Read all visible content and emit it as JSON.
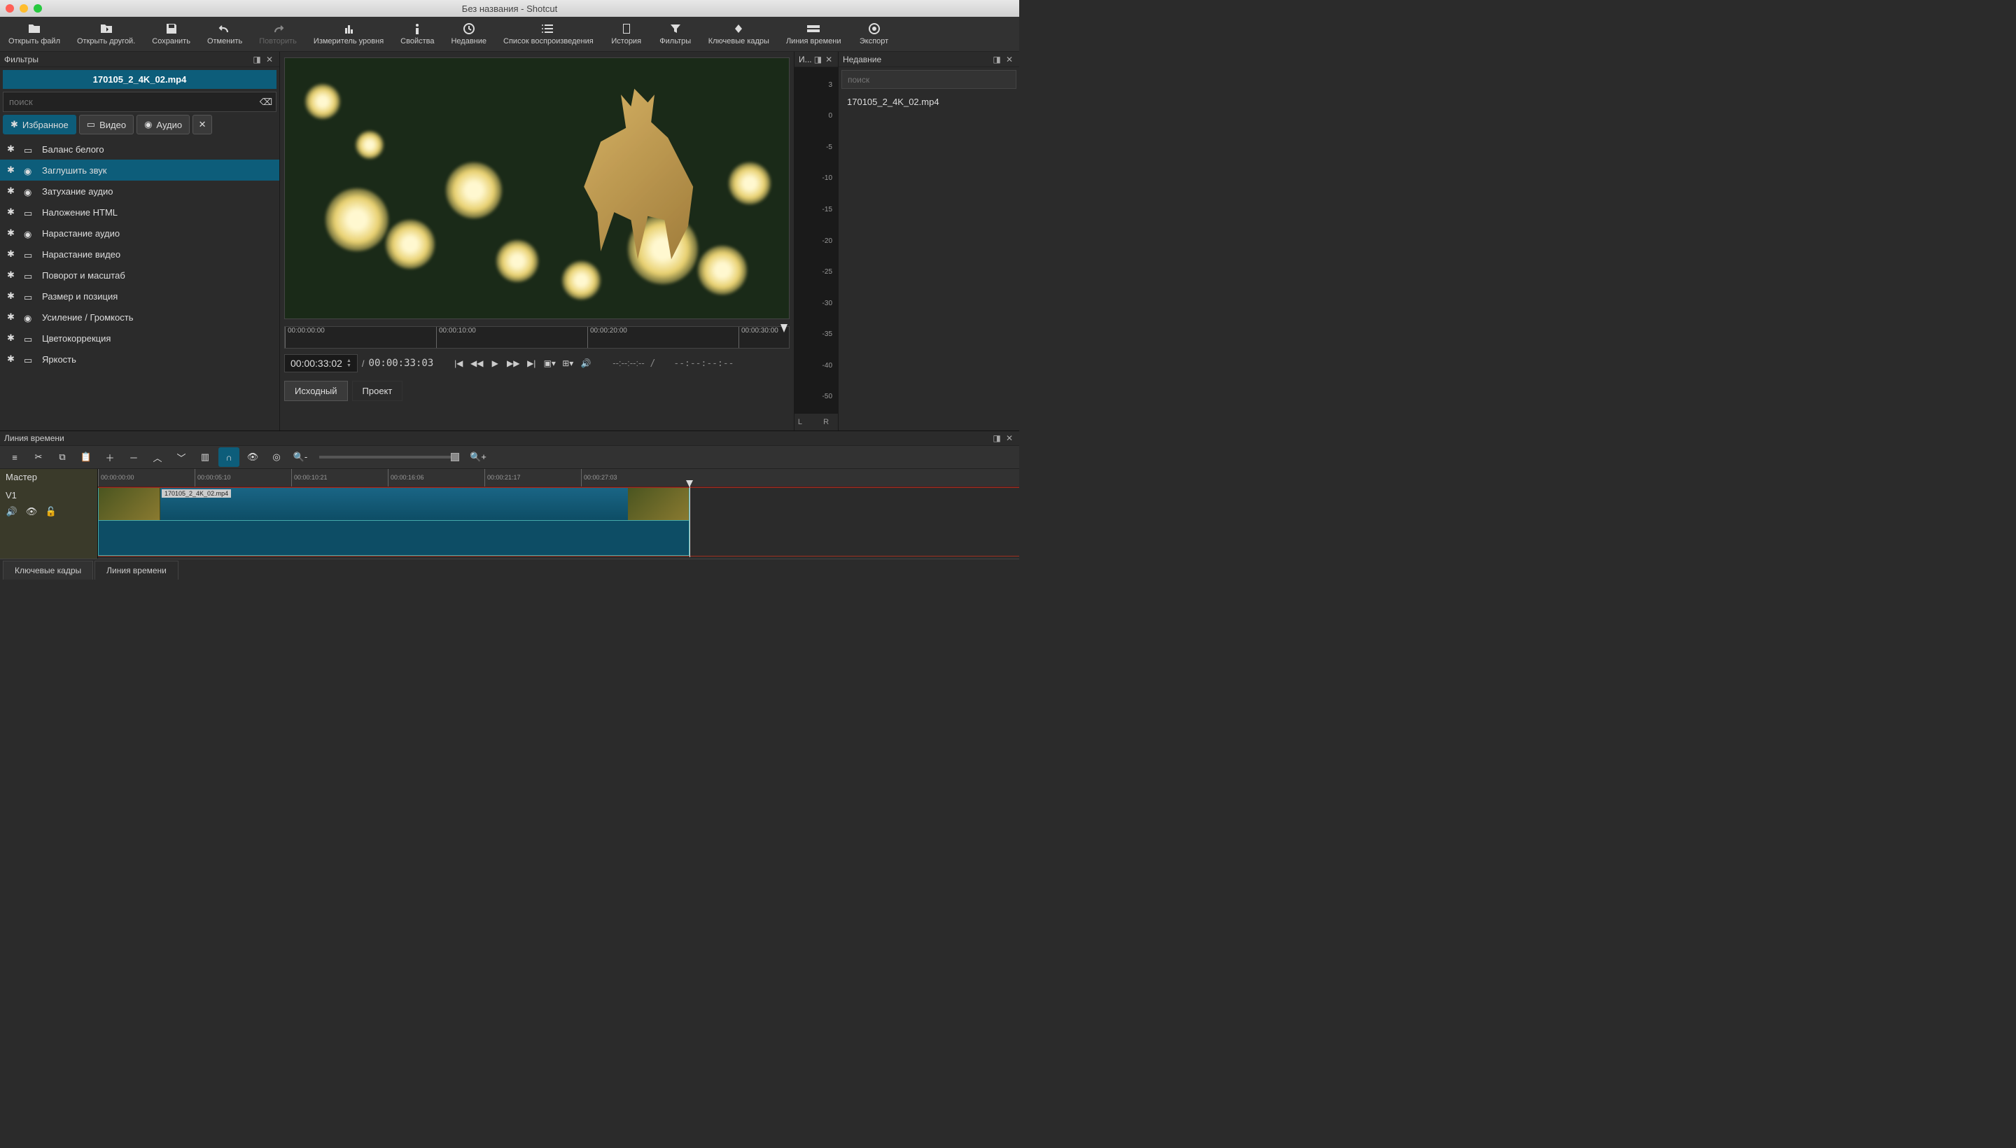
{
  "window": {
    "title": "Без названия - Shotcut"
  },
  "toolbar": [
    {
      "id": "open-file",
      "label": "Открыть файл",
      "icon": "folder"
    },
    {
      "id": "open-other",
      "label": "Открыть другой.",
      "icon": "folder-arrow"
    },
    {
      "id": "save",
      "label": "Сохранить",
      "icon": "save"
    },
    {
      "id": "undo",
      "label": "Отменить",
      "icon": "undo"
    },
    {
      "id": "redo",
      "label": "Повторить",
      "icon": "redo",
      "disabled": true
    },
    {
      "id": "peak-meter",
      "label": "Измеритель уровня",
      "icon": "meter"
    },
    {
      "id": "properties",
      "label": "Свойства",
      "icon": "info"
    },
    {
      "id": "recent",
      "label": "Недавние",
      "icon": "clock"
    },
    {
      "id": "playlist",
      "label": "Список воспроизведения",
      "icon": "list"
    },
    {
      "id": "history",
      "label": "История",
      "icon": "book"
    },
    {
      "id": "filters",
      "label": "Фильтры",
      "icon": "funnel"
    },
    {
      "id": "keyframes",
      "label": "Ключевые кадры",
      "icon": "keyframe"
    },
    {
      "id": "timeline",
      "label": "Линия времени",
      "icon": "timeline"
    },
    {
      "id": "export",
      "label": "Экспорт",
      "icon": "target"
    }
  ],
  "filtersPanel": {
    "title": "Фильтры",
    "clipName": "170105_2_4K_02.mp4",
    "searchPlaceholder": "поиск",
    "categories": [
      {
        "id": "fav",
        "label": "Избранное",
        "active": true
      },
      {
        "id": "video",
        "label": "Видео"
      },
      {
        "id": "audio",
        "label": "Аудио"
      }
    ],
    "items": [
      {
        "label": "Баланс белого",
        "kind": "video"
      },
      {
        "label": "Заглушить звук",
        "kind": "audio",
        "selected": true
      },
      {
        "label": "Затухание аудио",
        "kind": "audio"
      },
      {
        "label": "Наложение HTML",
        "kind": "video"
      },
      {
        "label": "Нарастание аудио",
        "kind": "audio"
      },
      {
        "label": "Нарастание видео",
        "kind": "video"
      },
      {
        "label": "Поворот и масштаб",
        "kind": "video"
      },
      {
        "label": "Размер и позиция",
        "kind": "video"
      },
      {
        "label": "Усиление / Громкость",
        "kind": "audio"
      },
      {
        "label": "Цветокоррекция",
        "kind": "video"
      },
      {
        "label": "Яркость",
        "kind": "video"
      }
    ]
  },
  "player": {
    "scrubTicks": [
      "00:00:00:00",
      "00:00:10:00",
      "00:00:20:00",
      "00:00:30:00"
    ],
    "timecode": "00:00:33:02",
    "duration": "00:00:33:03",
    "inout1": "--:--:--:--",
    "inout2": "--:--:--:--",
    "tabs": {
      "source": "Исходный",
      "project": "Проект"
    }
  },
  "meterPanel": {
    "title": "И...",
    "labels": [
      "3",
      "0",
      "-5",
      "-10",
      "-15",
      "-20",
      "-25",
      "-30",
      "-35",
      "-40",
      "-50"
    ],
    "lr": "L   R"
  },
  "recentPanel": {
    "title": "Недавние",
    "searchPlaceholder": "поиск",
    "items": [
      "170105_2_4K_02.mp4"
    ]
  },
  "timeline": {
    "title": "Линия времени",
    "master": "Мастер",
    "track": "V1",
    "rulerTicks": [
      "00:00:00:00",
      "00:00:05:10",
      "00:00:10:21",
      "00:00:16:06",
      "00:00:21:17",
      "00:00:27:03"
    ],
    "clipLabel": "170105_2_4K_02.mp4"
  },
  "bottomTabs": [
    {
      "label": "Ключевые кадры"
    },
    {
      "label": "Линия времени",
      "active": true
    }
  ]
}
